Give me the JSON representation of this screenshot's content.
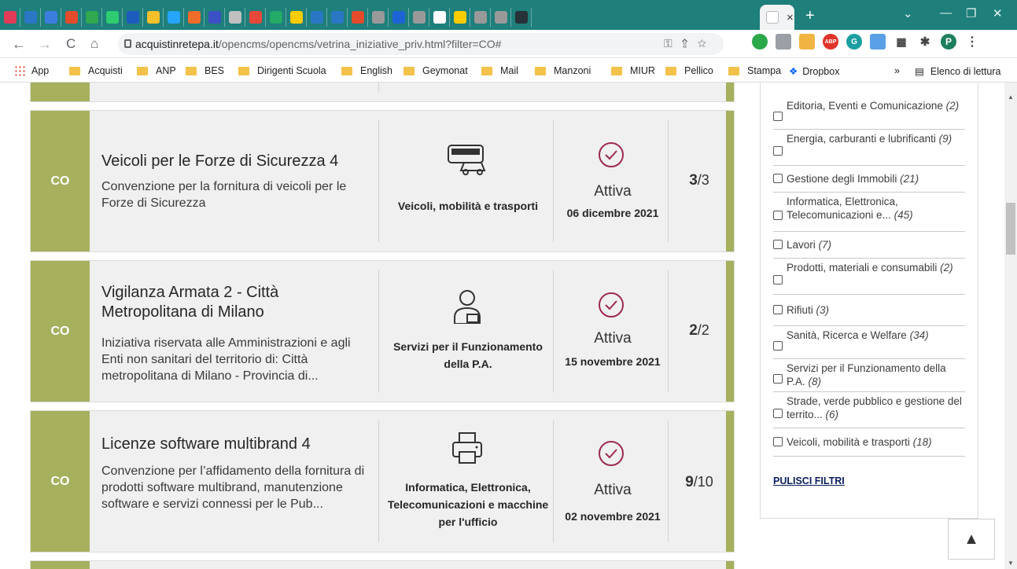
{
  "browser": {
    "tab_favicon_colors": [
      "#e23b57",
      "#2a78c5",
      "#3c7de0",
      "#e34b2b",
      "#2fa84f",
      "#2ecc71",
      "#1e5bbf",
      "#f6c02b",
      "#26a5ff",
      "#f06c2a",
      "#3b50c4",
      "#c0c0c0",
      "#e8483a",
      "#22aa66",
      "#ffcc00",
      "#2a78c5",
      "#2a78c5",
      "#e34b2b",
      "#999999",
      "#1d63d6",
      "#999999",
      "#ffffff",
      "#ffcc00",
      "#999999",
      "#999999",
      "#263238"
    ],
    "active_tab_close": "×",
    "new_tab": "+",
    "url_domain": "acquistinretepa.it",
    "url_path": "/opencms/opencms/vetrina_iniziative_priv.html?filter=CO#",
    "profile_initial": "P"
  },
  "bookmarks": {
    "apps": "App",
    "items": [
      "Acquisti",
      "ANP",
      "BES",
      "Dirigenti Scuola",
      "English",
      "Geymonat",
      "Mail",
      "Manzoni",
      "MIUR",
      "Pellico",
      "Stampa"
    ],
    "dropbox": "Dropbox",
    "more": "»",
    "reading_list": "Elenco di lettura"
  },
  "cards": [
    {
      "category": "CO",
      "title": "Veicoli per le Forze di Sicurezza 4",
      "description": "Convenzione per la fornitura di veicoli per le Forze di Sicurezza",
      "sector": "Veicoli, mobilità e trasporti",
      "sector_icon": "bus-car-icon",
      "status": "Attiva",
      "date": "06 dicembre 2021",
      "lots_active": "3",
      "lots_total": "/3"
    },
    {
      "category": "CO",
      "title": "Vigilanza Armata 2 - Città Metropolitana di Milano",
      "description": "Iniziativa riservata alle Amministrazioni e agli Enti non sanitari del territorio di: Città metropolitana di Milano - Provincia di...",
      "sector": "Servizi per il Funzionamento della P.A.",
      "sector_icon": "person-id-icon",
      "status": "Attiva",
      "date": "15 novembre 2021",
      "lots_active": "2",
      "lots_total": "/2"
    },
    {
      "category": "CO",
      "title": "Licenze software multibrand 4",
      "description": "Convenzione per l’affidamento della fornitura di prodotti software multibrand, manutenzione software e servizi connessi per le Pub...",
      "sector": "Informatica, Elettronica, Telecomunicazioni e macchine per l'ufficio",
      "sector_icon": "printer-icon",
      "status": "Attiva",
      "date": "02 novembre 2021",
      "lots_active": "9",
      "lots_total": "/10"
    }
  ],
  "filters": [
    {
      "label": "Editoria, Eventi e Comunicazione",
      "count": "(2)"
    },
    {
      "label": "Energia, carburanti e lubrificanti",
      "count": "(9)"
    },
    {
      "label": "Gestione degli Immobili",
      "count": "(21)"
    },
    {
      "label": "Informatica, Elettronica, Telecomunicazioni e...",
      "count": "(45)"
    },
    {
      "label": "Lavori",
      "count": "(7)"
    },
    {
      "label": "Prodotti, materiali e consumabili",
      "count": "(2)"
    },
    {
      "label": "Rifiuti",
      "count": "(3)"
    },
    {
      "label": "Sanità, Ricerca e Welfare",
      "count": "(34)"
    },
    {
      "label": "Servizi per il Funzionamento della P.A.",
      "count": "(8)"
    },
    {
      "label": "Strade, verde pubblico e gestione del territo...",
      "count": "(6)"
    },
    {
      "label": "Veicoli, mobilità e trasporti",
      "count": "(18)"
    }
  ],
  "clear_filters": "PULISCI FILTRI",
  "back_to_top": "^",
  "colors": {
    "accent_green": "#a6b05d",
    "status_check": "#9c2a52",
    "tabbar": "#1e7f7b"
  }
}
